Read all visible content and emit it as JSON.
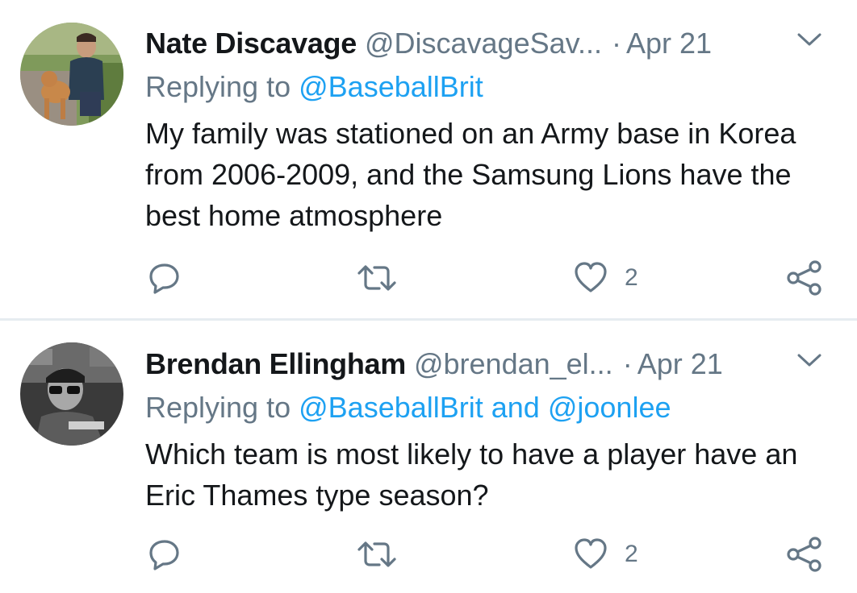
{
  "tweets": [
    {
      "name": "Nate Discavage",
      "handle": "@DiscavageSav...",
      "separator": "·",
      "date": "Apr 21",
      "replying_prefix": "Replying to",
      "replying_to": "@BaseballBrit",
      "text": "My family was stationed on an Army base in Korea from 2006-2009, and the Samsung Lions have the best home atmosphere",
      "like_count": "2"
    },
    {
      "name": "Brendan Ellingham",
      "handle": "@brendan_el...",
      "separator": "·",
      "date": "Apr 21",
      "replying_prefix": "Replying to",
      "replying_to": "@BaseballBrit and @joonlee",
      "text": "Which team is most likely to have a player have an Eric Thames type season?",
      "like_count": "2"
    }
  ],
  "icons": {
    "reply": "reply-icon",
    "retweet": "retweet-icon",
    "like": "heart-icon",
    "share": "share-icon",
    "menu": "chevron-down-icon"
  },
  "colors": {
    "link": "#1da1f2",
    "secondary_text": "#657786",
    "primary_text": "#14171a",
    "divider": "#e6ecf0"
  }
}
